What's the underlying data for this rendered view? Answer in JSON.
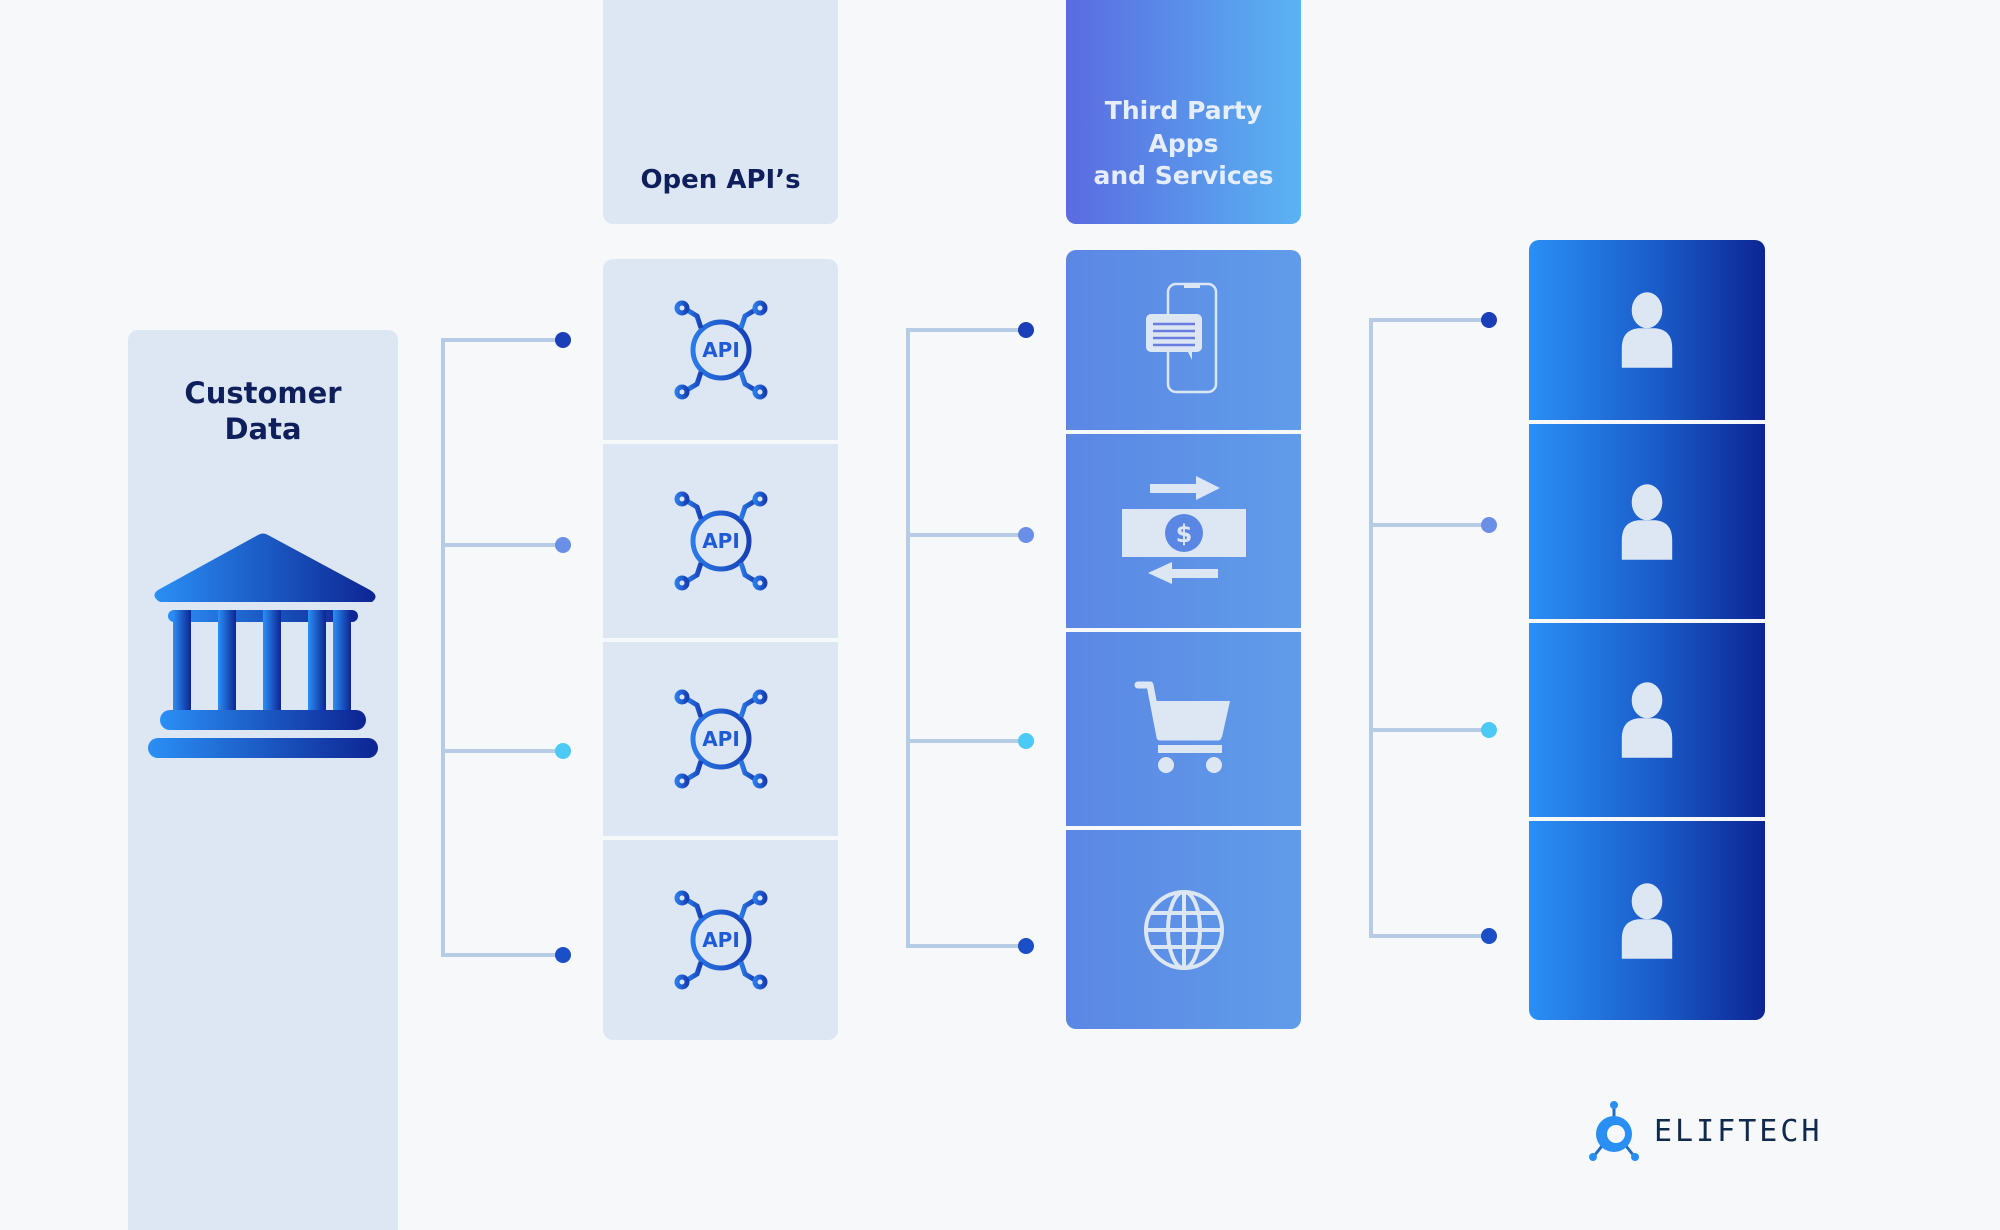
{
  "columns": {
    "customer_data": {
      "title_line1": "Customer",
      "title_line2": "Data",
      "icon": "bank-icon"
    },
    "open_apis": {
      "title": "Open API’s",
      "items": [
        {
          "label": "API"
        },
        {
          "label": "API"
        },
        {
          "label": "API"
        },
        {
          "label": "API"
        }
      ]
    },
    "third_party": {
      "title_line1": "Third Party",
      "title_line2": "Apps",
      "title_line3": "and Services",
      "items": [
        {
          "icon": "mobile-chat-icon"
        },
        {
          "icon": "money-transfer-icon"
        },
        {
          "icon": "shopping-cart-icon"
        },
        {
          "icon": "globe-icon"
        }
      ]
    },
    "users": {
      "items": [
        {
          "icon": "user-icon"
        },
        {
          "icon": "user-icon"
        },
        {
          "icon": "user-icon"
        },
        {
          "icon": "user-icon"
        }
      ]
    }
  },
  "connector_dot_colors": [
    "#1a3fb8",
    "#6a8fe6",
    "#4cc9f5",
    "#1a4fc8"
  ],
  "colors": {
    "background": "#f7f8fa",
    "panel": "#dde7f4",
    "title": "#0f1f5c",
    "line": "#b6cce4",
    "accent_start": "#2a8ff5",
    "accent_end": "#0d2593"
  },
  "logo": {
    "text": "ELIFTECH"
  }
}
